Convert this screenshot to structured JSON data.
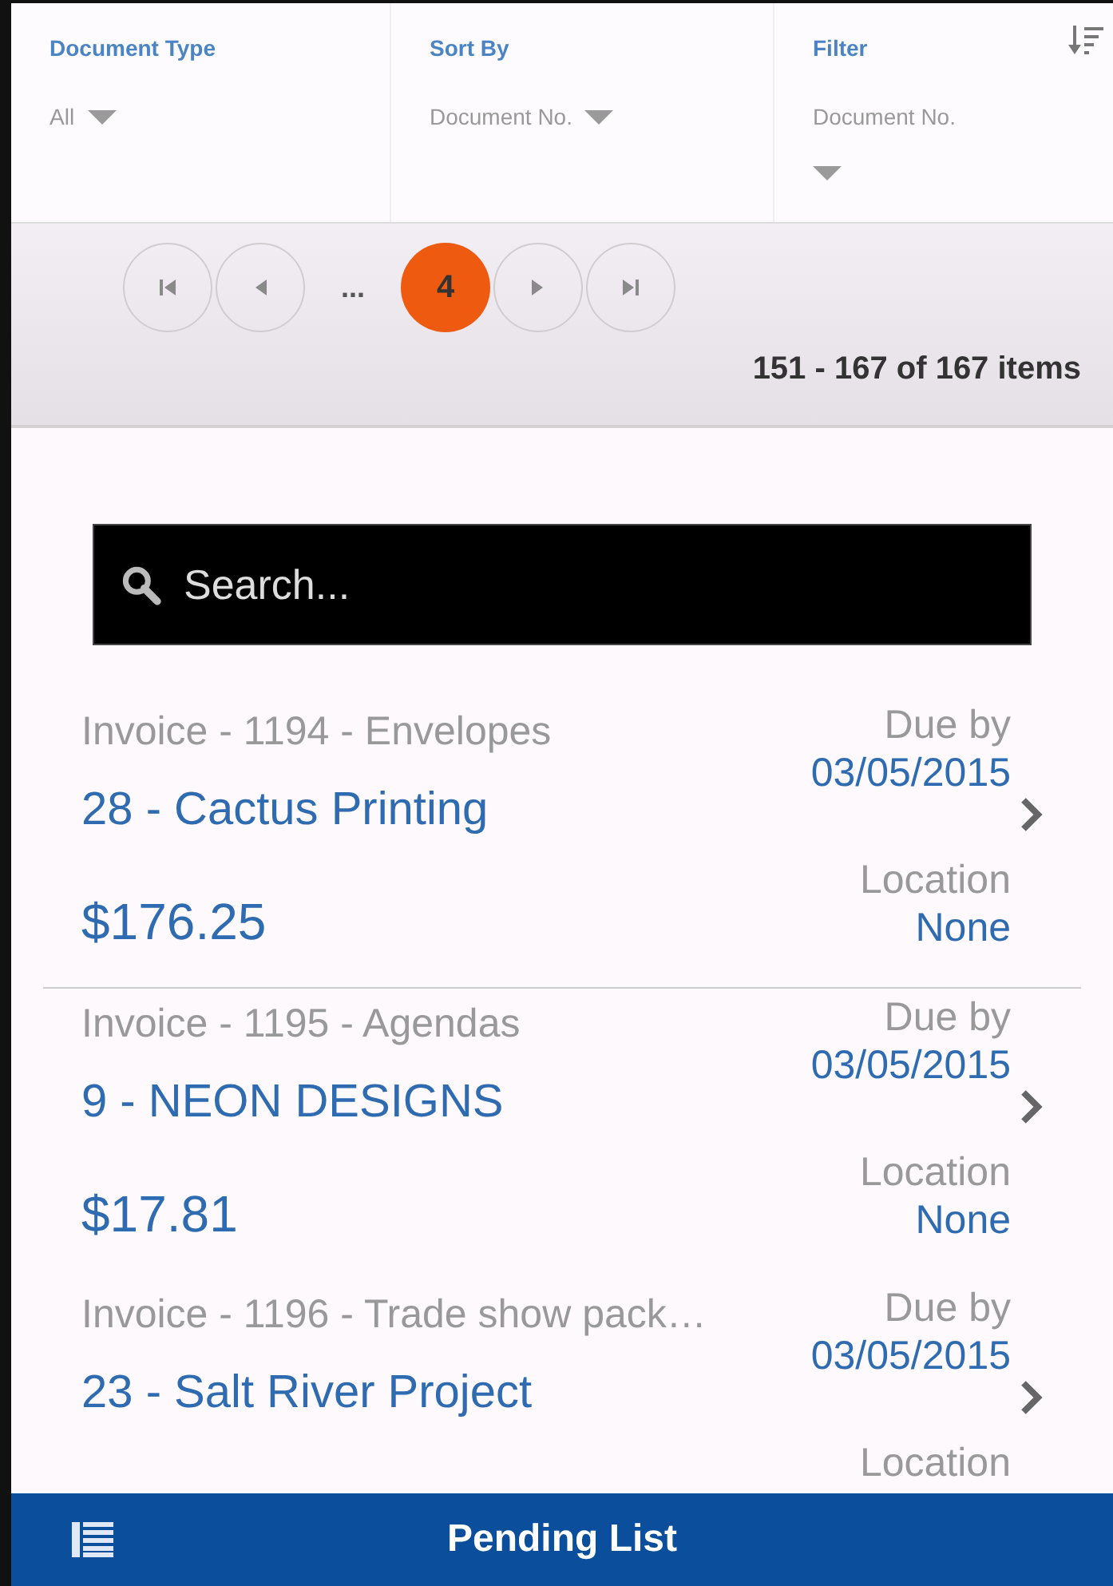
{
  "filters": [
    {
      "label": "Document Type",
      "value": "All",
      "caret_below": false
    },
    {
      "label": "Sort By",
      "value": "Document No.",
      "caret_below": false
    },
    {
      "label": "Filter",
      "value": "Document No.",
      "caret_below": true
    }
  ],
  "pager": [
    {
      "kind": "first"
    },
    {
      "kind": "prev"
    },
    {
      "kind": "ellipsis",
      "text": "..."
    },
    {
      "kind": "page",
      "text": "4",
      "selected": true
    },
    {
      "kind": "next"
    },
    {
      "kind": "last"
    }
  ],
  "range": "151 - 167 of 167 items",
  "search": {
    "placeholder": "Search..."
  },
  "items": [
    {
      "document": "Invoice - 1194 - Envelopes",
      "vendor": "28 - Cactus Printing",
      "amount": "$176.25",
      "due_label": "Due by",
      "due": "03/05/2015",
      "location_label": "Location",
      "location": "None"
    },
    {
      "document": "Invoice - 1195 - Agendas",
      "vendor": "9 - NEON DESIGNS",
      "amount": "$17.81",
      "due_label": "Due by",
      "due": "03/05/2015",
      "location_label": "Location",
      "location": "None"
    },
    {
      "document": "Invoice - 1196 - Trade show pack…",
      "vendor": "23 - Salt River Project",
      "due_label": "Due by",
      "due": "03/05/2015",
      "location_label": "Location"
    }
  ],
  "footer": {
    "title": "Pending List"
  }
}
